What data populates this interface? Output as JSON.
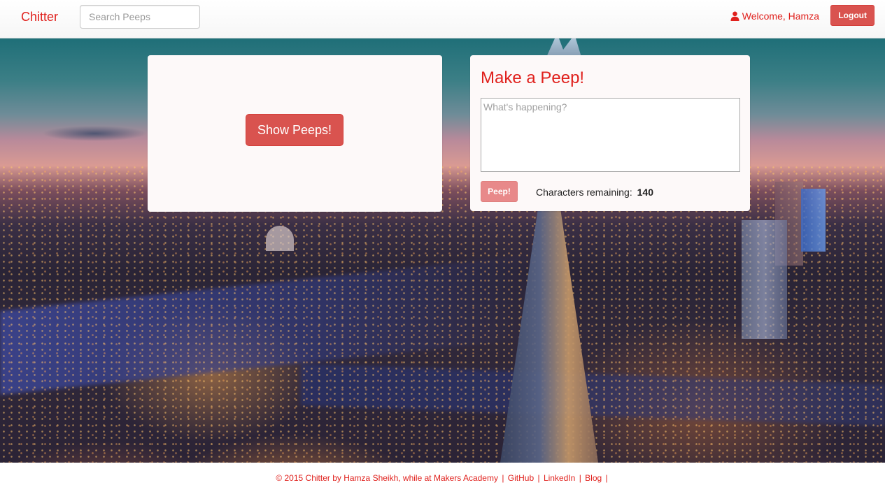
{
  "navbar": {
    "brand": "Chitter",
    "search_placeholder": "Search Peeps",
    "welcome": "Welcome, Hamza",
    "logout_label": "Logout"
  },
  "left_panel": {
    "show_button_label": "Show Peeps!"
  },
  "peep_form": {
    "title": "Make a Peep!",
    "textarea_placeholder": "What's happening?",
    "textarea_value": "",
    "submit_label": "Peep!",
    "chars_label": "Characters remaining:",
    "chars_remaining": "140"
  },
  "footer": {
    "credit": "© 2015 Chitter by Hamza Sheikh, while at Makers Academy",
    "links": [
      "GitHub",
      "LinkedIn",
      "Blog"
    ],
    "separator": "|"
  },
  "colors": {
    "brand_red": "#e0211d",
    "button_red": "#d9534f",
    "disabled_button": "#e8898a",
    "panel_bg": "#fdf9f9"
  },
  "icons": {
    "welcome": "user-icon"
  }
}
